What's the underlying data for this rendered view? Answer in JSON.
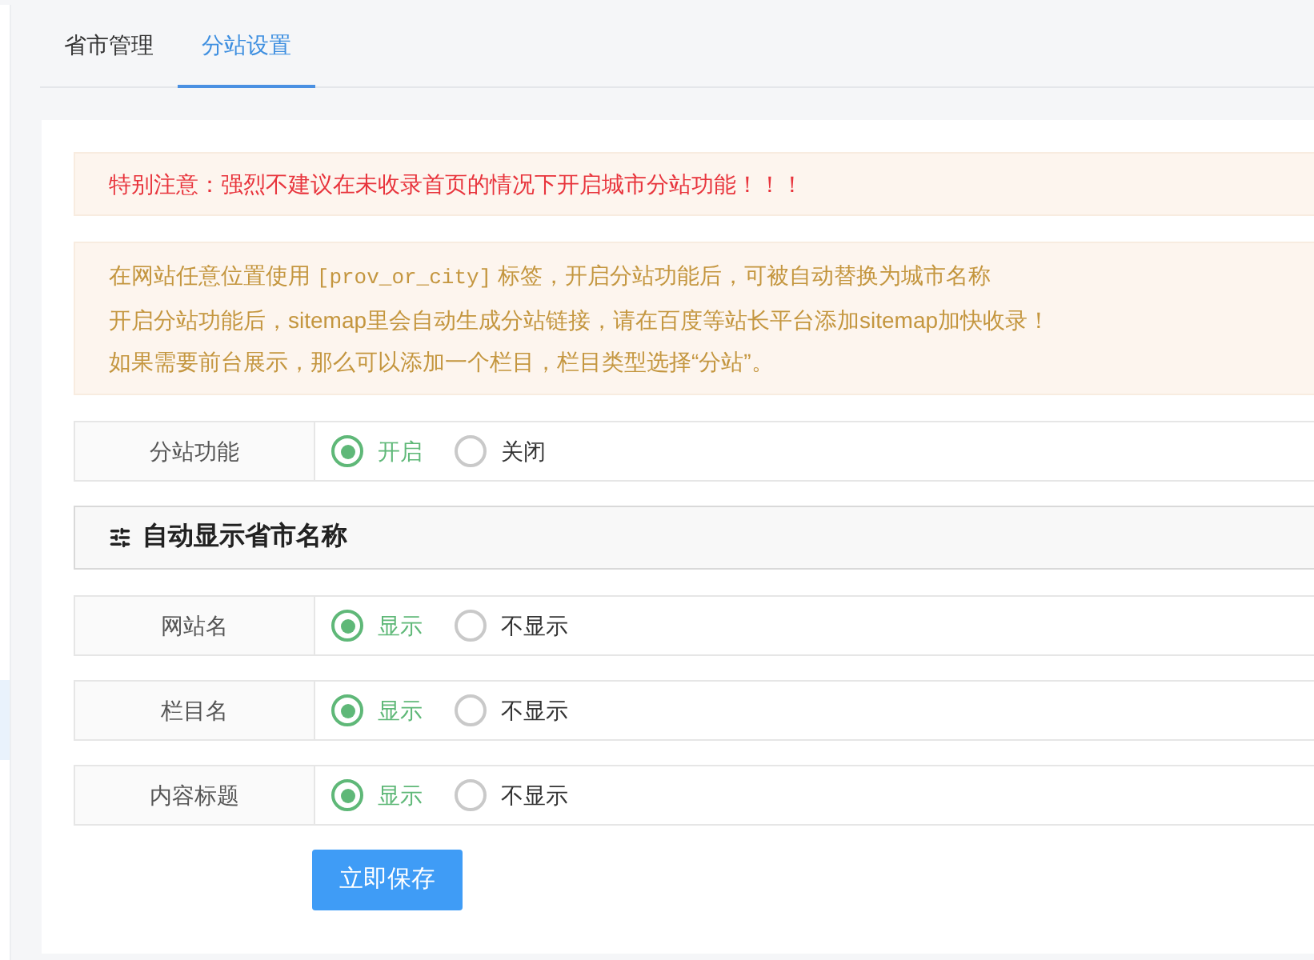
{
  "tabs": [
    {
      "label": "省市管理",
      "selected": false
    },
    {
      "label": "分站设置",
      "selected": true
    }
  ],
  "notices": [
    {
      "kind": "warning",
      "lines": [
        [
          {
            "kind": "text",
            "text": "特别注意：强烈不建议在未收录首页的情况下开启城市分站功能！！！"
          }
        ]
      ]
    },
    {
      "kind": "info",
      "lines": [
        [
          {
            "kind": "text",
            "text": "在网站任意位置使用 "
          },
          {
            "kind": "code",
            "text": "[prov_or_city]"
          },
          {
            "kind": "text",
            "text": " 标签，开启分站功能后，可被自动替换为城市名称"
          }
        ],
        [
          {
            "kind": "text",
            "text": "开启分站功能后，sitemap里会自动生成分站链接，请在百度等站长平台添加sitemap加快收录！"
          }
        ],
        [
          {
            "kind": "text",
            "text": "如果需要前台展示，那么可以添加一个栏目，栏目类型选择“分站”。"
          }
        ]
      ]
    }
  ],
  "main_settings": [
    {
      "label": "分站功能",
      "options": [
        {
          "label": "开启",
          "selected": true
        },
        {
          "label": "关闭",
          "selected": false
        }
      ]
    }
  ],
  "section": {
    "title": "自动显示省市名称"
  },
  "display_settings": [
    {
      "label": "网站名",
      "options": [
        {
          "label": "显示",
          "selected": true
        },
        {
          "label": "不显示",
          "selected": false
        }
      ]
    },
    {
      "label": "栏目名",
      "options": [
        {
          "label": "显示",
          "selected": true
        },
        {
          "label": "不显示",
          "selected": false
        }
      ]
    },
    {
      "label": "内容标题",
      "options": [
        {
          "label": "显示",
          "selected": true
        },
        {
          "label": "不显示",
          "selected": false
        }
      ]
    }
  ],
  "save_button": {
    "label": "立即保存"
  }
}
